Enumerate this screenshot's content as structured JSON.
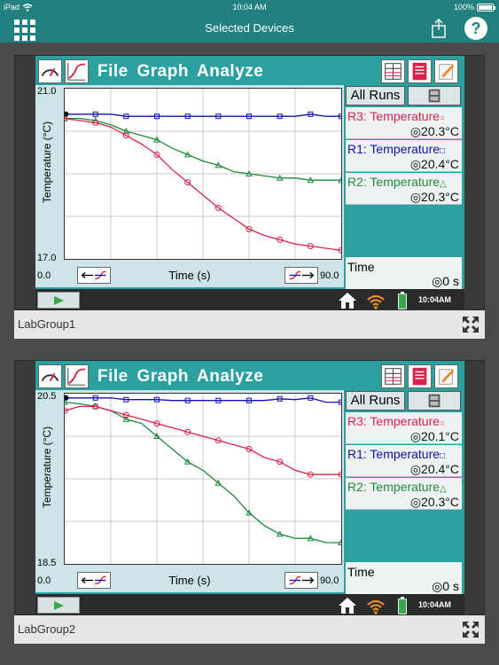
{
  "status_bar": {
    "device": "iPad",
    "time": "10:04 AM",
    "battery": "100%"
  },
  "nav": {
    "title": "Selected Devices"
  },
  "icons": {
    "menu": "grid-icon",
    "share": "share-icon",
    "help": "help-icon",
    "expand": "expand-icon"
  },
  "colors": {
    "accent": "#22807f",
    "run3": "#d9224a",
    "run1": "#1010b0",
    "run2": "#1e8a3a"
  },
  "devices": [
    {
      "app_title": "File  Graph  Analyze",
      "caption": "LabGroup1",
      "clock": "10:04AM",
      "all_runs_label": "All Runs",
      "graph": {
        "ylabel": "Temperature (°C)",
        "xlabel": "Time (s)",
        "ymax": "21.0",
        "ymin": "17.0",
        "xmin": "0.0",
        "xmax": "90.0"
      },
      "meters": [
        {
          "name": "R3: Temperature",
          "mark": "○",
          "value": "◎20.3°C",
          "color": "#d9224a"
        },
        {
          "name": "R1: Temperature",
          "mark": "□",
          "value": "◎20.4°C",
          "color": "#1010b0"
        },
        {
          "name": "R2: Temperature",
          "mark": "△",
          "value": "◎20.3°C",
          "color": "#1e8a3a"
        }
      ],
      "time_meter": {
        "name": "Time",
        "value": "◎0 s"
      }
    },
    {
      "app_title": "File  Graph  Analyze",
      "caption": "LabGroup2",
      "clock": "10:04AM",
      "all_runs_label": "All Runs",
      "graph": {
        "ylabel": "Temperature (°C)",
        "xlabel": "Time (s)",
        "ymax": "20.5",
        "ymin": "18.5",
        "xmin": "0.0",
        "xmax": "90.0"
      },
      "meters": [
        {
          "name": "R3: Temperature",
          "mark": "○",
          "value": "◎20.1°C",
          "color": "#d9224a"
        },
        {
          "name": "R1: Temperature",
          "mark": "□",
          "value": "◎20.4°C",
          "color": "#1010b0"
        },
        {
          "name": "R2: Temperature",
          "mark": "△",
          "value": "◎20.3°C",
          "color": "#1e8a3a"
        }
      ],
      "time_meter": {
        "name": "Time",
        "value": "◎0 s"
      }
    }
  ],
  "chart_data": [
    {
      "type": "line",
      "xlabel": "Time (s)",
      "ylabel": "Temperature (°C)",
      "xlim": [
        0,
        90
      ],
      "ylim": [
        17.0,
        21.0
      ],
      "grid": true,
      "series": [
        {
          "name": "R1: Temperature",
          "color": "#1010b0",
          "marker": "square",
          "x": [
            0,
            5,
            10,
            15,
            20,
            25,
            30,
            35,
            40,
            45,
            50,
            55,
            60,
            65,
            70,
            75,
            80,
            85,
            90
          ],
          "y": [
            20.4,
            20.4,
            20.4,
            20.4,
            20.35,
            20.35,
            20.35,
            20.35,
            20.35,
            20.35,
            20.35,
            20.35,
            20.35,
            20.35,
            20.35,
            20.35,
            20.4,
            20.35,
            20.35
          ]
        },
        {
          "name": "R2: Temperature",
          "color": "#1e8a3a",
          "marker": "triangle",
          "x": [
            0,
            5,
            10,
            15,
            20,
            25,
            30,
            35,
            40,
            45,
            50,
            55,
            60,
            65,
            70,
            75,
            80,
            85,
            90
          ],
          "y": [
            20.3,
            20.3,
            20.25,
            20.15,
            20.0,
            19.9,
            19.8,
            19.6,
            19.45,
            19.3,
            19.2,
            19.05,
            19.0,
            18.95,
            18.9,
            18.9,
            18.85,
            18.85,
            18.85
          ]
        },
        {
          "name": "R3: Temperature",
          "color": "#d9224a",
          "marker": "circle",
          "x": [
            0,
            5,
            10,
            15,
            20,
            25,
            30,
            35,
            40,
            45,
            50,
            55,
            60,
            65,
            70,
            75,
            80,
            85,
            90
          ],
          "y": [
            20.3,
            20.25,
            20.2,
            20.1,
            19.9,
            19.7,
            19.45,
            19.1,
            18.8,
            18.5,
            18.2,
            17.95,
            17.7,
            17.55,
            17.45,
            17.35,
            17.3,
            17.25,
            17.2
          ]
        }
      ]
    },
    {
      "type": "line",
      "xlabel": "Time (s)",
      "ylabel": "Temperature (°C)",
      "xlim": [
        0,
        90
      ],
      "ylim": [
        18.5,
        20.5
      ],
      "grid": true,
      "series": [
        {
          "name": "R1: Temperature",
          "color": "#1010b0",
          "marker": "square",
          "x": [
            0,
            5,
            10,
            15,
            20,
            25,
            30,
            35,
            40,
            45,
            50,
            55,
            60,
            65,
            70,
            75,
            80,
            85,
            90
          ],
          "y": [
            20.45,
            20.45,
            20.45,
            20.45,
            20.43,
            20.43,
            20.43,
            20.42,
            20.42,
            20.42,
            20.42,
            20.42,
            20.42,
            20.42,
            20.44,
            20.43,
            20.45,
            20.4,
            20.4
          ]
        },
        {
          "name": "R2: Temperature",
          "color": "#1e8a3a",
          "marker": "triangle",
          "x": [
            0,
            5,
            10,
            15,
            20,
            25,
            30,
            35,
            40,
            45,
            50,
            55,
            60,
            65,
            70,
            75,
            80,
            85,
            90
          ],
          "y": [
            20.4,
            20.38,
            20.35,
            20.3,
            20.2,
            20.15,
            20.0,
            19.85,
            19.7,
            19.6,
            19.45,
            19.3,
            19.1,
            18.95,
            18.85,
            18.8,
            18.8,
            18.75,
            18.75
          ]
        },
        {
          "name": "R3: Temperature",
          "color": "#d9224a",
          "marker": "circle",
          "x": [
            0,
            5,
            10,
            15,
            20,
            25,
            30,
            35,
            40,
            45,
            50,
            55,
            60,
            65,
            70,
            75,
            80,
            85,
            90
          ],
          "y": [
            20.3,
            20.35,
            20.35,
            20.3,
            20.25,
            20.2,
            20.15,
            20.1,
            20.05,
            20.0,
            19.95,
            19.9,
            19.85,
            19.75,
            19.7,
            19.6,
            19.55,
            19.55,
            19.55
          ]
        }
      ]
    }
  ]
}
